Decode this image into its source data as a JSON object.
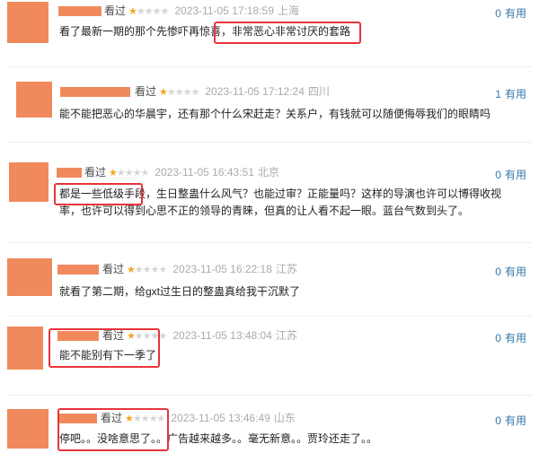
{
  "colors": {
    "accent_star": "#f6a623",
    "link_blue": "#3377aa",
    "highlight_red": "#e8333a",
    "avatar_orange": "#f08a5d"
  },
  "reviews": [
    {
      "watched": "看过",
      "stars": 1,
      "time": "2023-11-05 17:18:59",
      "location": "上海",
      "useful_count": "0",
      "useful_label": "有用",
      "text": "看了最新一期的那个先惨吓再惊喜，非常恶心非常讨厌的套路"
    },
    {
      "watched": "看过",
      "stars": 1,
      "time": "2023-11-05 17:12:24",
      "location": "四川",
      "useful_count": "1",
      "useful_label": "有用",
      "text": "能不能把恶心的华晨宇，还有那个什么宋赶走？关系户，有钱就可以随便侮辱我们的眼睛吗"
    },
    {
      "watched": "看过",
      "stars": 1,
      "time": "2023-11-05 16:43:51",
      "location": "北京",
      "useful_count": "0",
      "useful_label": "有用",
      "text": "都是一些低级手段，生日整蛊什么风气？也能过审？正能量吗？这样的导演也许可以博得收视率，也许可以得到心思不正的领导的青睐，但真的让人看不起一眼。蓝台气数到头了。"
    },
    {
      "watched": "看过",
      "stars": 1,
      "time": "2023-11-05 16:22:18",
      "location": "江苏",
      "useful_count": "0",
      "useful_label": "有用",
      "text": "就看了第二期，给gxt过生日的整蛊真给我干沉默了"
    },
    {
      "watched": "看过",
      "stars": 1,
      "time": "2023-11-05 13:48:04",
      "location": "江苏",
      "useful_count": "0",
      "useful_label": "有用",
      "text": "能不能别有下一季了"
    },
    {
      "watched": "看过",
      "stars": 1,
      "time": "2023-11-05 13:46:49",
      "location": "山东",
      "useful_count": "0",
      "useful_label": "有用",
      "text": "停吧。。没啥意思了。。广告越来越多。。毫无新意。。贾玲还走了。。"
    }
  ]
}
